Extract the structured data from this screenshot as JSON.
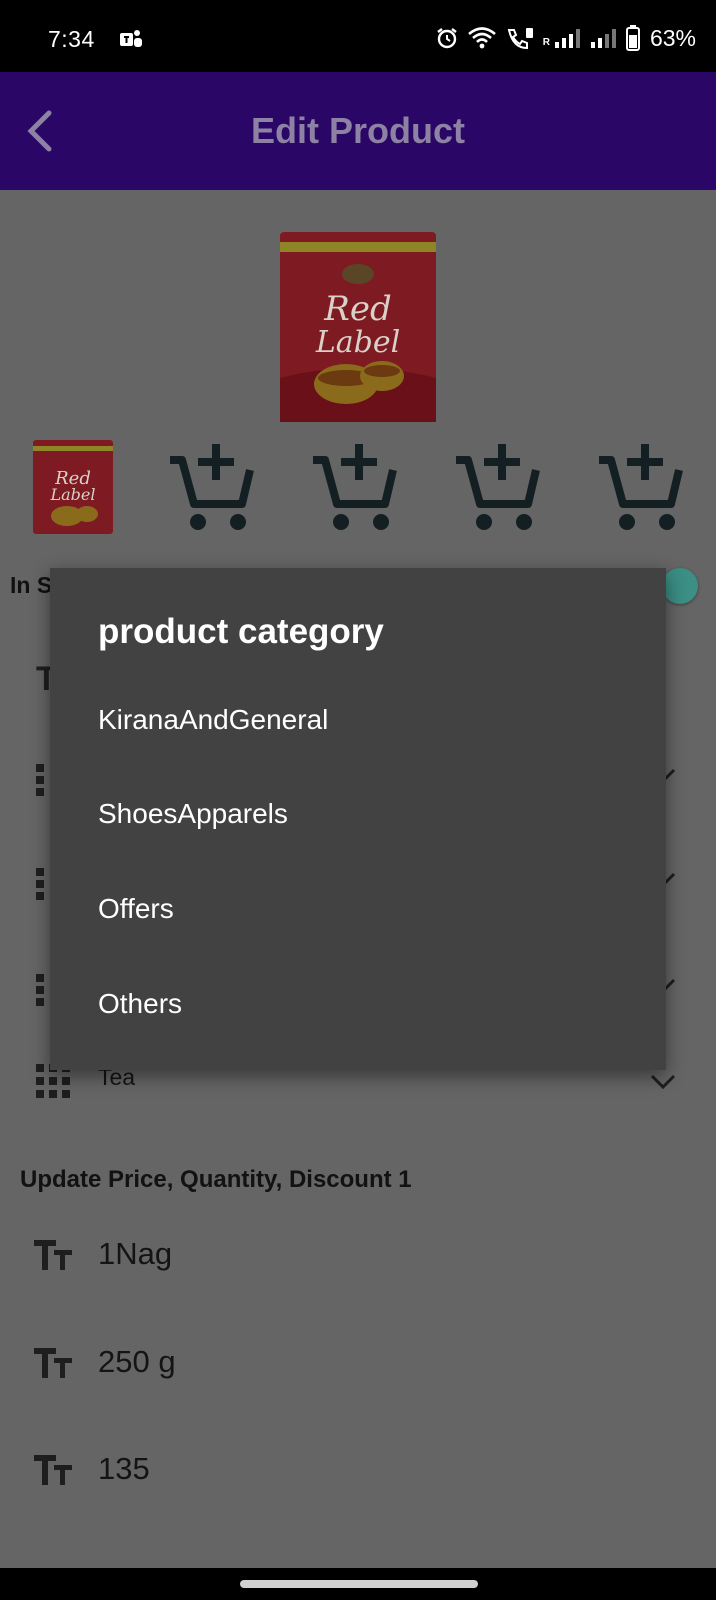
{
  "status_bar": {
    "time": "7:34",
    "battery": "63%",
    "network_tag": "R",
    "icons": [
      "teams-icon",
      "alarm-icon",
      "wifi-icon",
      "wifi-calling-icon",
      "signal-icon",
      "signal-icon",
      "battery-icon"
    ]
  },
  "app_bar": {
    "title": "Edit Product",
    "back_icon": "chevron-left-icon",
    "color": "#2a0767"
  },
  "product": {
    "main_image": "red-label-tea-pack",
    "thumbnails": [
      "red-label-tea-pack",
      "add-to-cart-icon",
      "add-to-cart-icon",
      "add-to-cart-icon",
      "add-to-cart-icon"
    ]
  },
  "in_stock": {
    "label": "In S",
    "toggle_on": true
  },
  "background_fields": {
    "sub_category_value": "Tea"
  },
  "pricing": {
    "section_title": "Update Price, Quantity, Discount 1",
    "rows": [
      {
        "value": "1Nag"
      },
      {
        "value": "250 g"
      },
      {
        "value": "135"
      }
    ]
  },
  "dialog": {
    "title": "product category",
    "options": [
      "KiranaAndGeneral",
      "ShoesApparels",
      "Offers",
      "Others"
    ]
  },
  "colors": {
    "dialog_bg": "#424242",
    "scrim_content": "#656565",
    "toggle": "#3b8f85"
  }
}
